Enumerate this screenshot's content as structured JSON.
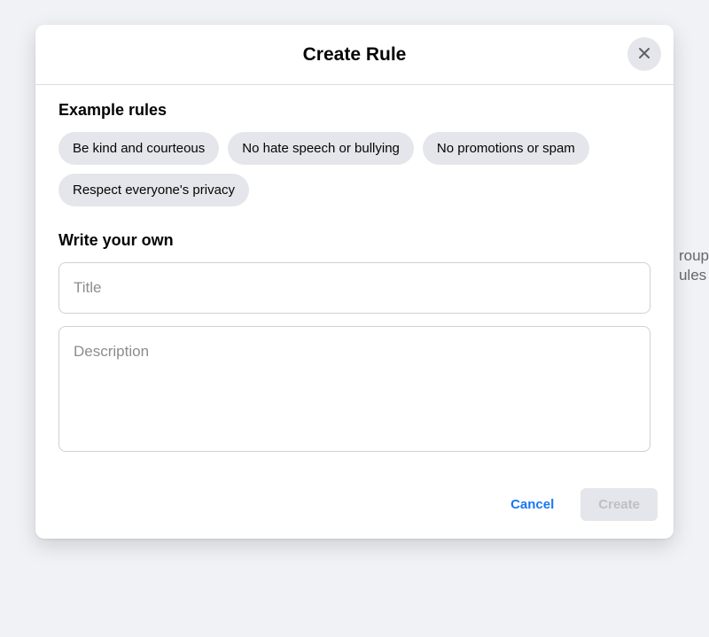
{
  "backdrop": {
    "line1": "roup",
    "line2": "ules"
  },
  "modal": {
    "title": "Create Rule",
    "example_section": {
      "heading": "Example rules",
      "chips": [
        "Be kind and courteous",
        "No hate speech or bullying",
        "No promotions or spam",
        "Respect everyone's privacy"
      ]
    },
    "write_section": {
      "heading": "Write your own",
      "title_placeholder": "Title",
      "title_value": "",
      "description_placeholder": "Description",
      "description_value": ""
    },
    "footer": {
      "cancel_label": "Cancel",
      "create_label": "Create",
      "create_disabled": true
    }
  }
}
